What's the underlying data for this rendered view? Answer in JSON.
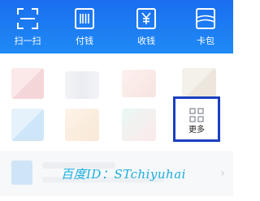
{
  "quick_actions": [
    {
      "label": "扫一扫",
      "icon": "scan-icon"
    },
    {
      "label": "付钱",
      "icon": "barcode-icon"
    },
    {
      "label": "收钱",
      "icon": "yuan-icon"
    },
    {
      "label": "卡包",
      "icon": "wallet-icon"
    }
  ],
  "more_tile": {
    "label": "更多",
    "icon": "grid-icon"
  },
  "watermark": "百度ID：STchiyuhai",
  "colors": {
    "bar_blue": "#1a6eef",
    "highlight_border": "#1a3fc2",
    "watermark": "#19aee0"
  }
}
